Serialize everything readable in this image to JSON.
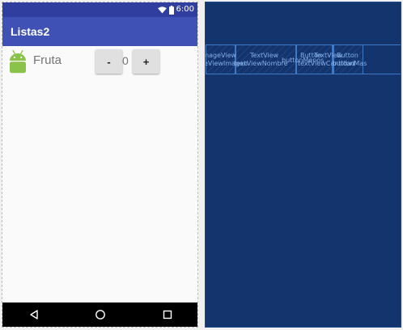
{
  "status_bar": {
    "time": "6:00",
    "icons": [
      "wifi-icon",
      "battery-icon"
    ]
  },
  "app_bar": {
    "title": "Listas2"
  },
  "item_row": {
    "image_icon": "android-icon",
    "name": "Fruta",
    "minus_label": "-",
    "count": "0",
    "plus_label": "+"
  },
  "nav_bar": {
    "icons": [
      "back-icon",
      "home-icon",
      "recents-icon"
    ]
  },
  "blueprint": {
    "components": [
      {
        "type": "ImageView",
        "id": "imageViewImagen"
      },
      {
        "type": "TextView",
        "id": "textViewNombre"
      },
      {
        "type": "Button",
        "id": "buttonMenos"
      },
      {
        "type": "TextView",
        "id": "textViewCantidad"
      },
      {
        "type": "Button",
        "id": "buttonMas"
      }
    ]
  },
  "colors": {
    "status_bar": "#303f9f",
    "app_bar": "#3f51b5",
    "blueprint_bg": "#14346e",
    "blueprint_line": "#3f79c4"
  }
}
